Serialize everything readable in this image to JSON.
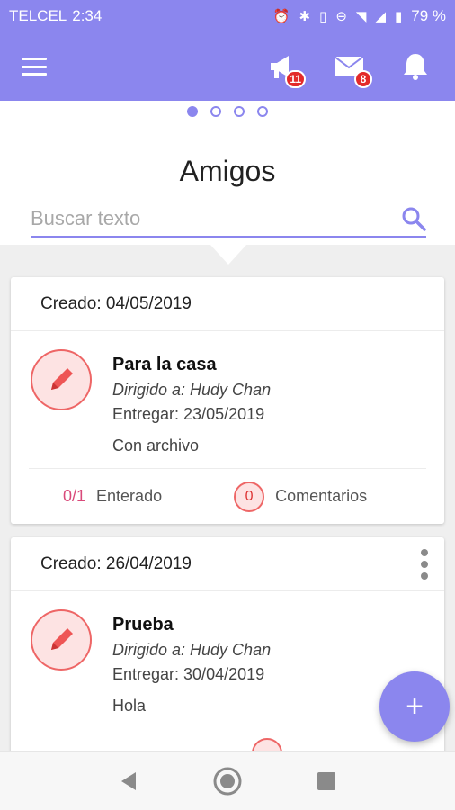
{
  "status_bar": {
    "carrier": "TELCEL",
    "time": "2:34",
    "battery": "79 %"
  },
  "app_bar": {
    "menu_icon": "hamburger-icon",
    "actions": [
      {
        "icon": "megaphone-icon",
        "badge": "11"
      },
      {
        "icon": "mail-icon",
        "badge": "8"
      },
      {
        "icon": "bell-icon"
      }
    ]
  },
  "pager": {
    "pages": 4,
    "active": 0
  },
  "page": {
    "title": "Amigos"
  },
  "search": {
    "placeholder": "Buscar texto",
    "value": ""
  },
  "cards": [
    {
      "created": "Creado: 04/05/2019",
      "title": "Para la casa",
      "to": "Dirigido a: Hudy Chan",
      "due": "Entregar: 23/05/2019",
      "note": "Con archivo",
      "read_count": "0/1",
      "read_label": "Enterado",
      "comments": "0",
      "comments_label": "Comentarios"
    },
    {
      "created": "Creado: 26/04/2019",
      "title": "Prueba",
      "to": "Dirigido a: Hudy Chan",
      "due": "Entregar: 30/04/2019",
      "note": "Hola"
    }
  ],
  "fab": {
    "label": "+"
  },
  "colors": {
    "primary": "#8b86ee",
    "badge": "#e32a2a",
    "accent_pink": "#d94a7a"
  }
}
